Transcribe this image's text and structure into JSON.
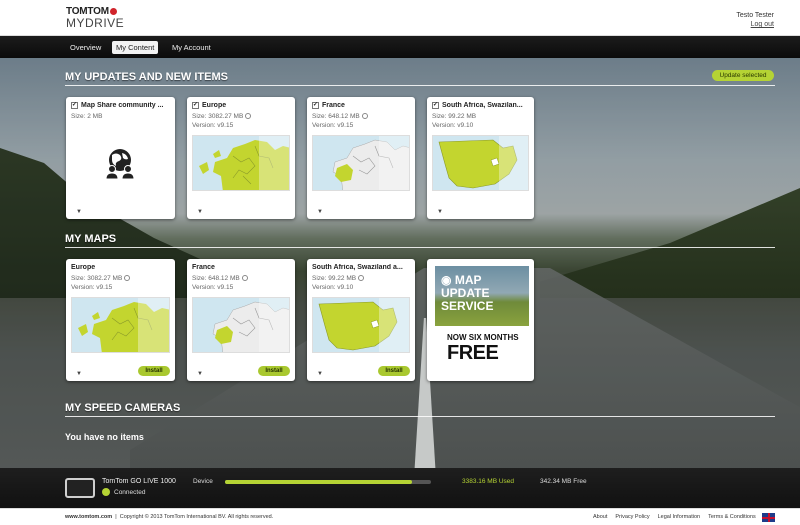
{
  "brand": {
    "line1": "TOMTOM",
    "line2": "MYDRIVE"
  },
  "user": {
    "name": "Testo Tester",
    "logout": "Log out"
  },
  "nav": {
    "tabs": [
      "Overview",
      "My Content",
      "My Account"
    ],
    "active": "My Content"
  },
  "updates": {
    "title": "MY UPDATES AND NEW ITEMS",
    "update_button": "Update selected",
    "items": [
      {
        "title": "Map Share community ...",
        "size": "Size: 2 MB",
        "version": "",
        "checked": true,
        "icon": "globe-people-icon"
      },
      {
        "title": "Europe",
        "size": "Size: 3082.27 MB",
        "version": "Version: v9.15",
        "checked": true,
        "icon": "europe-map"
      },
      {
        "title": "France",
        "size": "Size: 648.12 MB",
        "version": "Version: v9.15",
        "checked": true,
        "icon": "france-map"
      },
      {
        "title": "South Africa, Swazilan...",
        "size": "Size: 99.22 MB",
        "version": "Version: v9.10",
        "checked": true,
        "icon": "south-africa-map"
      }
    ]
  },
  "maps": {
    "title": "MY MAPS",
    "install_label": "Install",
    "items": [
      {
        "title": "Europe",
        "size": "Size: 3082.27 MB",
        "version": "Version: v9.15"
      },
      {
        "title": "France",
        "size": "Size: 648.12 MB",
        "version": "Version: v9.15"
      },
      {
        "title": "South Africa, Swaziland a...",
        "size": "Size: 99.22 MB",
        "version": "Version: v9.10"
      }
    ],
    "promo": {
      "line1": "MAP",
      "line2": "UPDATE",
      "line3": "SERVICE",
      "line4": "NOW SIX MONTHS",
      "line5": "FREE"
    }
  },
  "cameras": {
    "title": "MY SPEED CAMERAS",
    "empty": "You have no items"
  },
  "device": {
    "name": "TomTom GO LIVE 1000",
    "status": "Connected",
    "label": "Device",
    "used": "3383.16 MB Used",
    "free": "342.34 MB Free",
    "usage_fraction": 0.908
  },
  "footer": {
    "site": "www.tomtom.com",
    "copyright": "Copyright © 2013 TomTom International BV. All rights reserved.",
    "links": [
      "About",
      "Privacy Policy",
      "Legal Information",
      "Terms & Conditions"
    ]
  },
  "colors": {
    "accent": "#b5d334",
    "brand_red": "#d0242b"
  }
}
